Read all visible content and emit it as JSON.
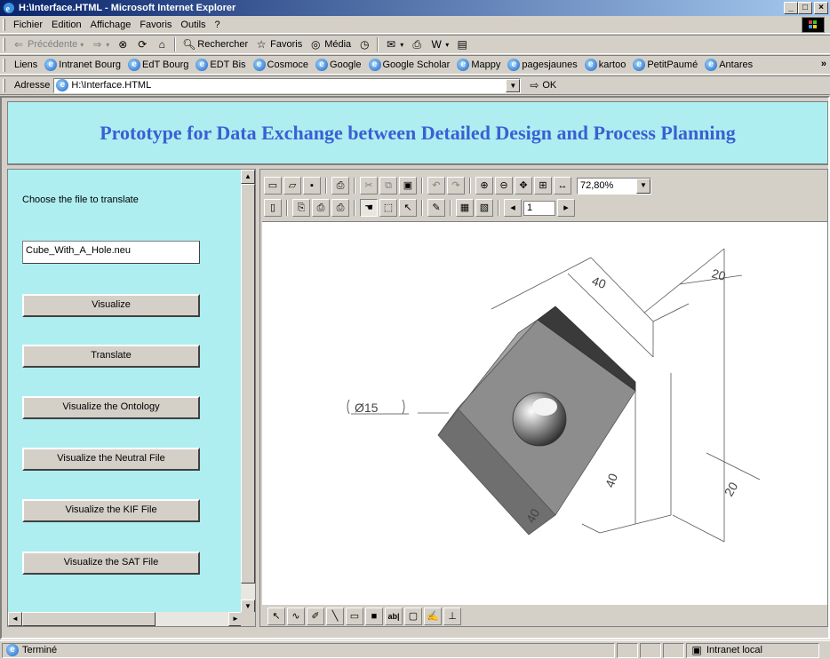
{
  "window": {
    "title": "H:\\Interface.HTML - Microsoft Internet Explorer"
  },
  "menu": [
    "Fichier",
    "Edition",
    "Affichage",
    "Favoris",
    "Outils",
    "?"
  ],
  "toolbar": {
    "back": "Précédente",
    "search": "Rechercher",
    "favorites": "Favoris",
    "media": "Média"
  },
  "links": {
    "label": "Liens",
    "items": [
      "Intranet Bourg",
      "EdT Bourg",
      "EDT Bis",
      "Cosmoce",
      "Google",
      "Google Scholar",
      "Mappy",
      "pagesjaunes",
      "kartoo",
      "PetitPaumé",
      "Antares"
    ],
    "more": "»"
  },
  "address": {
    "label": "Adresse",
    "value": "H:\\Interface.HTML",
    "go": "OK"
  },
  "banner": {
    "title": "Prototype for Data Exchange between Detailed Design and Process Planning"
  },
  "left": {
    "choose_label": "Choose the file to translate",
    "file_value": "Cube_With_A_Hole.neu",
    "buttons": [
      "Visualize",
      "Translate",
      "Visualize the Ontology",
      "Visualize the Neutral File",
      "Visualize the KIF File",
      "Visualize the SAT File"
    ]
  },
  "viewer": {
    "zoom": "72,80%",
    "page": "1",
    "dimensions": {
      "top_width": "40",
      "top_right": "20",
      "hole": "Ø15",
      "side_height": "40",
      "right_low": "20",
      "corner": "40"
    }
  },
  "status": {
    "text": "Terminé",
    "zone": "Intranet local"
  }
}
